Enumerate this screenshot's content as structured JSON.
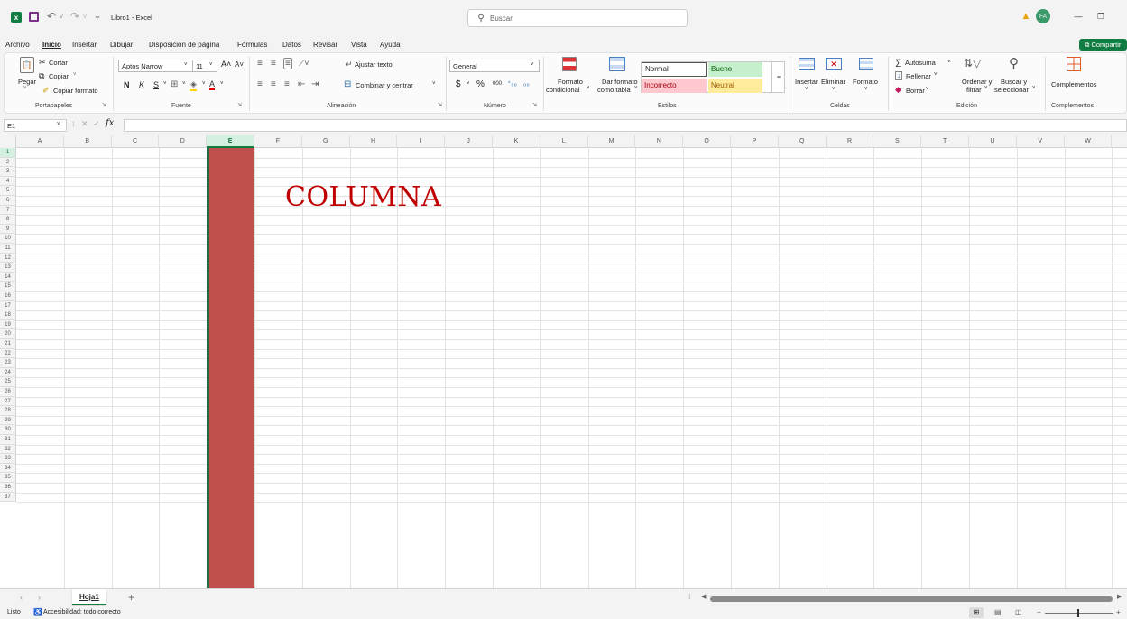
{
  "titlebar": {
    "title": "Libro1 - Excel",
    "search_placeholder": "Buscar",
    "avatar_initials": "FA",
    "minimize": "—",
    "restore": "❐"
  },
  "menu": {
    "items": [
      "Archivo",
      "Inicio",
      "Insertar",
      "Dibujar",
      "Disposición de página",
      "Fórmulas",
      "Datos",
      "Revisar",
      "Vista",
      "Ayuda"
    ],
    "share": "Compartir"
  },
  "ribbon": {
    "clipboard": {
      "paste": "Pegar",
      "cut": "Cortar",
      "copy": "Copiar",
      "copy_format": "Copiar formato",
      "label": "Portapapeles"
    },
    "font": {
      "name": "Aptos Narrow",
      "size": "11",
      "bold": "N",
      "italic": "K",
      "underline": "S",
      "label": "Fuente"
    },
    "alignment": {
      "wrap": "Ajustar texto",
      "merge": "Combinar y centrar",
      "label": "Alineación"
    },
    "number": {
      "format": "General",
      "currency": "$",
      "percent": "%",
      "thousands": "000",
      "label": "Número"
    },
    "styles": {
      "cond_format_1": "Formato",
      "cond_format_2": "condicional",
      "table_format_1": "Dar formato",
      "table_format_2": "como tabla",
      "normal": "Normal",
      "bueno": "Bueno",
      "incorrecto": "Incorrecto",
      "neutral": "Neutral",
      "label": "Estilos"
    },
    "cells": {
      "insert": "Insertar",
      "delete": "Eliminar",
      "format": "Formato",
      "label": "Celdas"
    },
    "editing": {
      "autosum": "Autosuma",
      "fill": "Rellenar",
      "clear": "Borrar",
      "sort_1": "Ordenar y",
      "sort_2": "filtrar",
      "find_1": "Buscar y",
      "find_2": "seleccionar",
      "label": "Edición"
    },
    "addins": {
      "button": "Complementos",
      "label": "Complementos"
    }
  },
  "formula_bar": {
    "name_box": "E1",
    "fx": "fx",
    "content": ""
  },
  "grid": {
    "columns": [
      "A",
      "B",
      "C",
      "D",
      "E",
      "F",
      "G",
      "H",
      "I",
      "J",
      "K",
      "L",
      "M",
      "N",
      "O",
      "P",
      "Q",
      "R",
      "S",
      "T",
      "U",
      "V",
      "W"
    ],
    "rows": [
      "1",
      "2",
      "3",
      "4",
      "5",
      "6",
      "7",
      "8",
      "9",
      "10",
      "11",
      "12",
      "13",
      "14",
      "15",
      "16",
      "17",
      "18",
      "19",
      "20",
      "21",
      "22",
      "23",
      "24",
      "25",
      "26",
      "27",
      "28",
      "29",
      "30",
      "31",
      "32",
      "33",
      "34",
      "35",
      "36",
      "37"
    ],
    "selected_column": "E",
    "highlight_color": "#c0504d",
    "annotation": "COLUMNA",
    "annotation_color": "#c00000"
  },
  "sheets": {
    "tabs": [
      "Hoja1"
    ],
    "add": "+"
  },
  "status": {
    "ready": "Listo",
    "accessibility": "Accesibilidad: todo correcto"
  }
}
